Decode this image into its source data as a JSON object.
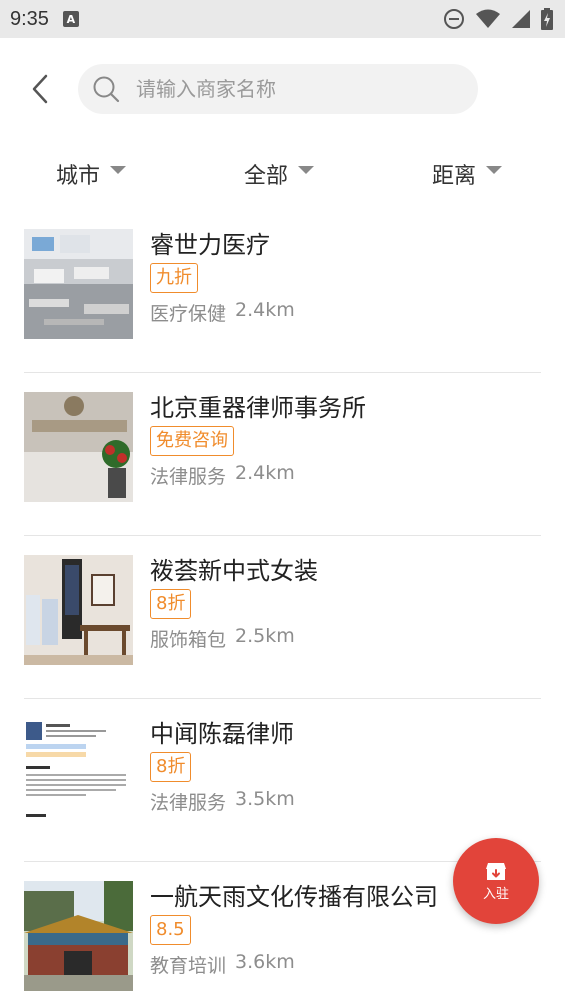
{
  "status_bar": {
    "time": "9:35",
    "notification_icon": "A",
    "icons": [
      "do-not-disturb-icon",
      "wifi-icon",
      "signal-icon",
      "battery-icon"
    ]
  },
  "header": {
    "search_placeholder": "请输入商家名称"
  },
  "filters": [
    {
      "label": "城市"
    },
    {
      "label": "全部"
    },
    {
      "label": "距离"
    }
  ],
  "merchants": [
    {
      "name": "睿世力医疗",
      "tag": "九折",
      "category": "医疗保健",
      "distance": "2.4km"
    },
    {
      "name": "北京重器律师事务所",
      "tag": "免费咨询",
      "category": "法律服务",
      "distance": "2.4km"
    },
    {
      "name": "袯荟新中式女装",
      "tag": "8折",
      "category": "服饰箱包",
      "distance": "2.5km"
    },
    {
      "name": "中闻陈磊律师",
      "tag": "8折",
      "category": "法律服务",
      "distance": "3.5km"
    },
    {
      "name": "一航天雨文化传播有限公司",
      "tag": "8.5",
      "category": "教育培训",
      "distance": "3.6km"
    }
  ],
  "fab": {
    "label": "入驻"
  },
  "colors": {
    "tag": "#f08c2c",
    "fab": "#e2443a",
    "status_bar": "#e9e9e9"
  }
}
